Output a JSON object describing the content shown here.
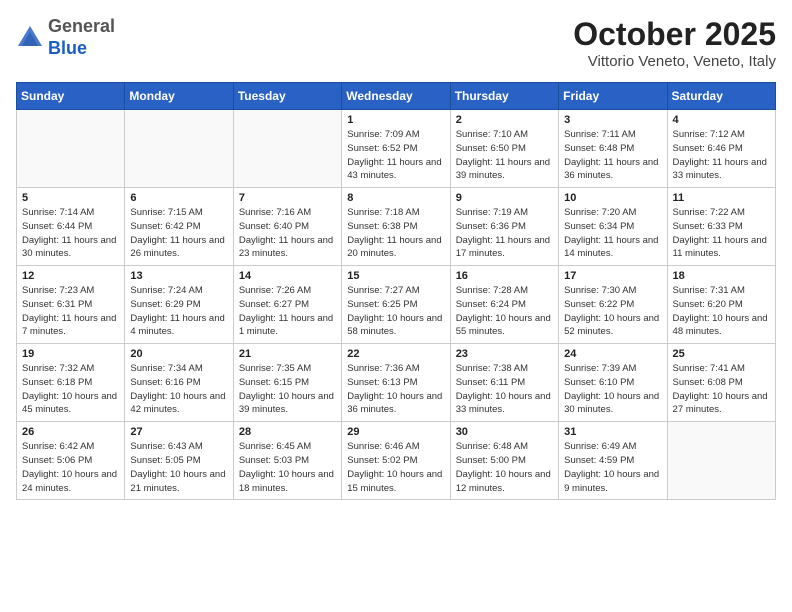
{
  "header": {
    "logo_general": "General",
    "logo_blue": "Blue",
    "month_title": "October 2025",
    "location": "Vittorio Veneto, Veneto, Italy"
  },
  "weekdays": [
    "Sunday",
    "Monday",
    "Tuesday",
    "Wednesday",
    "Thursday",
    "Friday",
    "Saturday"
  ],
  "weeks": [
    [
      {
        "day": "",
        "info": ""
      },
      {
        "day": "",
        "info": ""
      },
      {
        "day": "",
        "info": ""
      },
      {
        "day": "1",
        "info": "Sunrise: 7:09 AM\nSunset: 6:52 PM\nDaylight: 11 hours\nand 43 minutes."
      },
      {
        "day": "2",
        "info": "Sunrise: 7:10 AM\nSunset: 6:50 PM\nDaylight: 11 hours\nand 39 minutes."
      },
      {
        "day": "3",
        "info": "Sunrise: 7:11 AM\nSunset: 6:48 PM\nDaylight: 11 hours\nand 36 minutes."
      },
      {
        "day": "4",
        "info": "Sunrise: 7:12 AM\nSunset: 6:46 PM\nDaylight: 11 hours\nand 33 minutes."
      }
    ],
    [
      {
        "day": "5",
        "info": "Sunrise: 7:14 AM\nSunset: 6:44 PM\nDaylight: 11 hours\nand 30 minutes."
      },
      {
        "day": "6",
        "info": "Sunrise: 7:15 AM\nSunset: 6:42 PM\nDaylight: 11 hours\nand 26 minutes."
      },
      {
        "day": "7",
        "info": "Sunrise: 7:16 AM\nSunset: 6:40 PM\nDaylight: 11 hours\nand 23 minutes."
      },
      {
        "day": "8",
        "info": "Sunrise: 7:18 AM\nSunset: 6:38 PM\nDaylight: 11 hours\nand 20 minutes."
      },
      {
        "day": "9",
        "info": "Sunrise: 7:19 AM\nSunset: 6:36 PM\nDaylight: 11 hours\nand 17 minutes."
      },
      {
        "day": "10",
        "info": "Sunrise: 7:20 AM\nSunset: 6:34 PM\nDaylight: 11 hours\nand 14 minutes."
      },
      {
        "day": "11",
        "info": "Sunrise: 7:22 AM\nSunset: 6:33 PM\nDaylight: 11 hours\nand 11 minutes."
      }
    ],
    [
      {
        "day": "12",
        "info": "Sunrise: 7:23 AM\nSunset: 6:31 PM\nDaylight: 11 hours\nand 7 minutes."
      },
      {
        "day": "13",
        "info": "Sunrise: 7:24 AM\nSunset: 6:29 PM\nDaylight: 11 hours\nand 4 minutes."
      },
      {
        "day": "14",
        "info": "Sunrise: 7:26 AM\nSunset: 6:27 PM\nDaylight: 11 hours\nand 1 minute."
      },
      {
        "day": "15",
        "info": "Sunrise: 7:27 AM\nSunset: 6:25 PM\nDaylight: 10 hours\nand 58 minutes."
      },
      {
        "day": "16",
        "info": "Sunrise: 7:28 AM\nSunset: 6:24 PM\nDaylight: 10 hours\nand 55 minutes."
      },
      {
        "day": "17",
        "info": "Sunrise: 7:30 AM\nSunset: 6:22 PM\nDaylight: 10 hours\nand 52 minutes."
      },
      {
        "day": "18",
        "info": "Sunrise: 7:31 AM\nSunset: 6:20 PM\nDaylight: 10 hours\nand 48 minutes."
      }
    ],
    [
      {
        "day": "19",
        "info": "Sunrise: 7:32 AM\nSunset: 6:18 PM\nDaylight: 10 hours\nand 45 minutes."
      },
      {
        "day": "20",
        "info": "Sunrise: 7:34 AM\nSunset: 6:16 PM\nDaylight: 10 hours\nand 42 minutes."
      },
      {
        "day": "21",
        "info": "Sunrise: 7:35 AM\nSunset: 6:15 PM\nDaylight: 10 hours\nand 39 minutes."
      },
      {
        "day": "22",
        "info": "Sunrise: 7:36 AM\nSunset: 6:13 PM\nDaylight: 10 hours\nand 36 minutes."
      },
      {
        "day": "23",
        "info": "Sunrise: 7:38 AM\nSunset: 6:11 PM\nDaylight: 10 hours\nand 33 minutes."
      },
      {
        "day": "24",
        "info": "Sunrise: 7:39 AM\nSunset: 6:10 PM\nDaylight: 10 hours\nand 30 minutes."
      },
      {
        "day": "25",
        "info": "Sunrise: 7:41 AM\nSunset: 6:08 PM\nDaylight: 10 hours\nand 27 minutes."
      }
    ],
    [
      {
        "day": "26",
        "info": "Sunrise: 6:42 AM\nSunset: 5:06 PM\nDaylight: 10 hours\nand 24 minutes."
      },
      {
        "day": "27",
        "info": "Sunrise: 6:43 AM\nSunset: 5:05 PM\nDaylight: 10 hours\nand 21 minutes."
      },
      {
        "day": "28",
        "info": "Sunrise: 6:45 AM\nSunset: 5:03 PM\nDaylight: 10 hours\nand 18 minutes."
      },
      {
        "day": "29",
        "info": "Sunrise: 6:46 AM\nSunset: 5:02 PM\nDaylight: 10 hours\nand 15 minutes."
      },
      {
        "day": "30",
        "info": "Sunrise: 6:48 AM\nSunset: 5:00 PM\nDaylight: 10 hours\nand 12 minutes."
      },
      {
        "day": "31",
        "info": "Sunrise: 6:49 AM\nSunset: 4:59 PM\nDaylight: 10 hours\nand 9 minutes."
      },
      {
        "day": "",
        "info": ""
      }
    ]
  ]
}
